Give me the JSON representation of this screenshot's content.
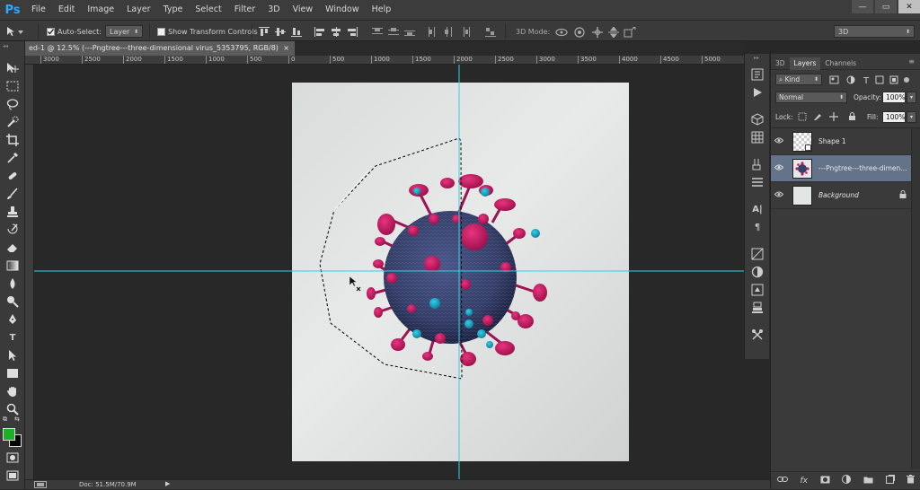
{
  "app": {
    "logo": "Ps"
  },
  "menu": [
    "File",
    "Edit",
    "Image",
    "Layer",
    "Type",
    "Select",
    "Filter",
    "3D",
    "View",
    "Window",
    "Help"
  ],
  "window_controls": {
    "minimize": "—",
    "restore": "▭",
    "close": "✕"
  },
  "options_bar": {
    "auto_select_label": "Auto-Select:",
    "auto_select_value": "Layer",
    "show_transform_label": "Show Transform Controls",
    "three_d_mode_label": "3D Mode:",
    "workspace_value": "3D"
  },
  "document": {
    "tab_title": "ed-1 @ 12.5% (---Pngtree---three-dimensional virus_5353795, RGB/8) *",
    "tab_close": "×"
  },
  "ruler": {
    "ticks": [
      "3000",
      "2500",
      "2000",
      "1500",
      "1000",
      "500",
      "0",
      "500",
      "1000",
      "1500",
      "2000",
      "2500",
      "3000",
      "3500",
      "4000",
      "4500",
      "5000"
    ]
  },
  "layers_panel": {
    "tabs": [
      "3D",
      "Layers",
      "Channels"
    ],
    "active_tab": "Layers",
    "filter_kind": "Kind",
    "blend_mode": "Normal",
    "opacity_label": "Opacity:",
    "opacity_value": "100%",
    "lock_label": "Lock:",
    "fill_label": "Fill:",
    "fill_value": "100%",
    "layers": [
      {
        "name": "Shape 1",
        "selected": false
      },
      {
        "name": "---Pngtree---three-dimen...",
        "selected": true
      },
      {
        "name": "Background",
        "selected": false,
        "locked": true
      }
    ]
  },
  "status": {
    "doc_info": "Doc: 51.5M/70.9M"
  },
  "colors": {
    "foreground": "#1fae2a",
    "background": "#000000",
    "guide": "#34d0e0",
    "selected_layer": "#63738a",
    "virus_body": "#36416a",
    "virus_spike": "#c71a64",
    "virus_dot": "#19a8c4"
  }
}
